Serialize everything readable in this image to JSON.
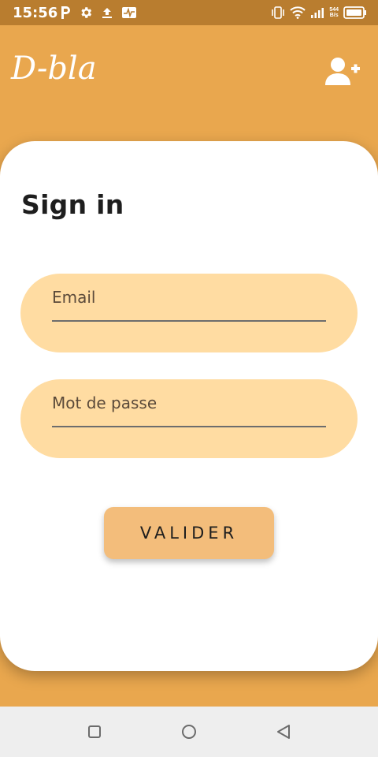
{
  "status_bar": {
    "time": "15:56",
    "net_speed_value": "544",
    "net_speed_unit": "B/s",
    "icons": [
      "parking-icon",
      "gear-icon",
      "upload-icon",
      "activity-icon",
      "vibrate-icon",
      "wifi-icon",
      "signal-icon",
      "battery-icon"
    ]
  },
  "app_bar": {
    "logo_text": "D-bla",
    "action_icon": "add-user-icon"
  },
  "form": {
    "title": "Sign in",
    "email_label": "Email",
    "password_label": "Mot de passe",
    "submit_label": "VALIDER"
  },
  "nav_bar": {
    "icons": [
      "recent-apps-icon",
      "home-icon",
      "back-icon"
    ]
  },
  "colors": {
    "background": "#E9A74E",
    "status_bar": "#B97D2F",
    "field_fill": "#FFDCA2",
    "button_fill": "#F3BD7B",
    "card": "#FFFFFF"
  }
}
